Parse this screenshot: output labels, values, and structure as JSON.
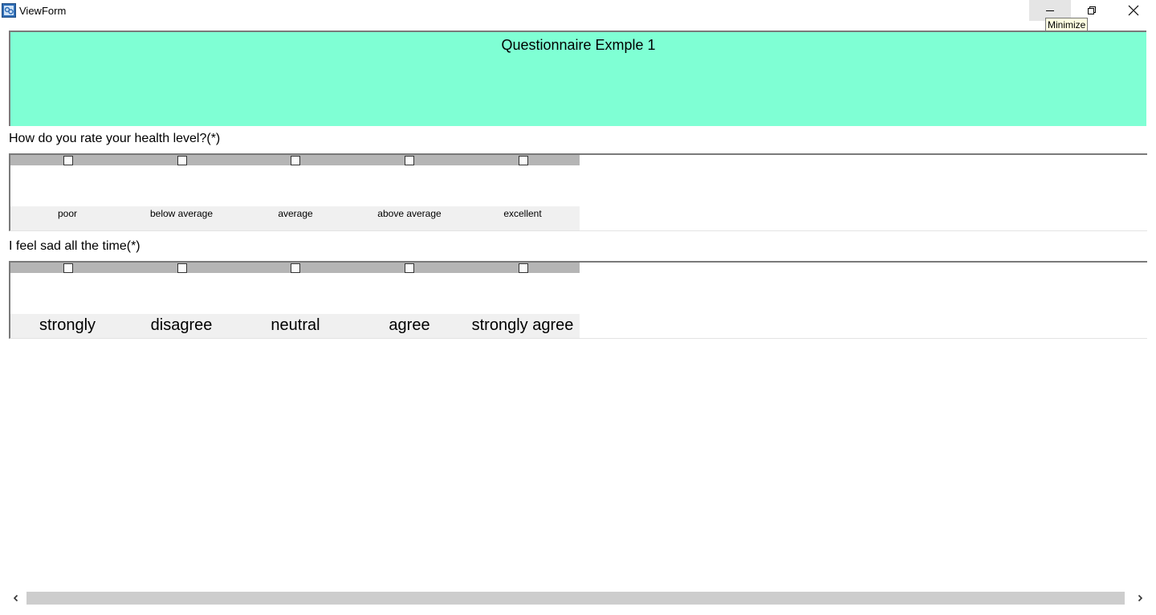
{
  "window": {
    "title": "ViewForm",
    "tooltip": "Minimize",
    "icons": {
      "app": "form-app-icon",
      "minimize": "minimize-icon",
      "restore": "restore-icon",
      "close": "close-icon"
    }
  },
  "header": {
    "title": "Questionnaire Exmple 1",
    "background": "#7fffd4"
  },
  "questions": [
    {
      "label": "How do you rate your health level?(*)",
      "options": [
        "poor",
        "below average",
        "average",
        "above average",
        "excellent"
      ]
    },
    {
      "label": "I feel sad all the time(*)",
      "options": [
        "strongly",
        "disagree",
        "neutral",
        "agree",
        "strongly agree"
      ]
    }
  ],
  "scrollbar": {
    "left_arrow": "‹",
    "right_arrow": "›"
  }
}
